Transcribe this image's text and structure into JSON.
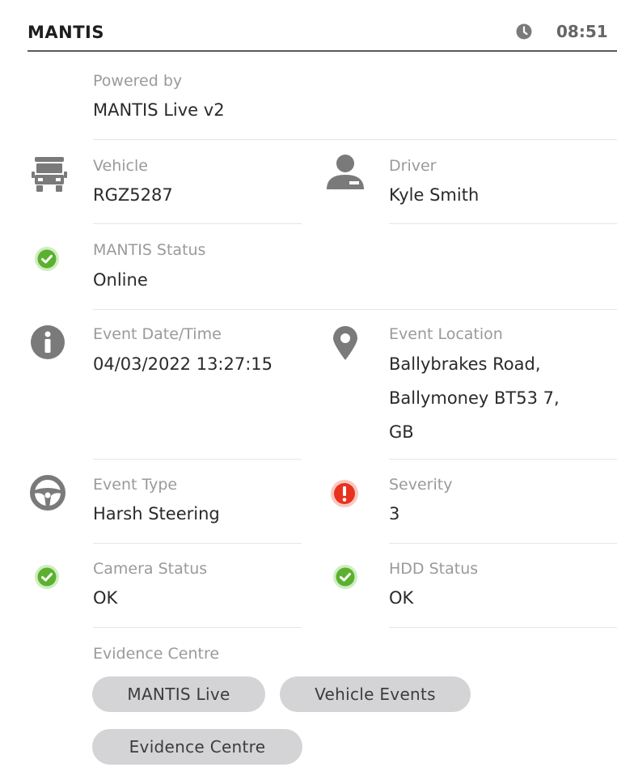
{
  "header": {
    "title": "MANTIS",
    "time": "08:51"
  },
  "powered": {
    "label": "Powered by",
    "value": "MANTIS Live v2"
  },
  "vehicle": {
    "label": "Vehicle",
    "value": "RGZ5287"
  },
  "driver": {
    "label": "Driver",
    "value": "Kyle Smith"
  },
  "mantis_status": {
    "label": "MANTIS Status",
    "value": "Online"
  },
  "event_datetime": {
    "label": "Event Date/Time",
    "value": "04/03/2022 13:27:15"
  },
  "event_location": {
    "label": "Event Location",
    "lines": [
      "Ballybrakes Road,",
      "Ballymoney BT53 7,",
      "GB"
    ]
  },
  "event_type": {
    "label": "Event Type",
    "value": "Harsh Steering"
  },
  "severity": {
    "label": "Severity",
    "value": "3"
  },
  "camera_status": {
    "label": "Camera Status",
    "value": "OK"
  },
  "hdd_status": {
    "label": "HDD Status",
    "value": "OK"
  },
  "evidence": {
    "label": "Evidence Centre",
    "buttons": [
      "MANTIS Live",
      "Vehicle Events",
      "Evidence Centre"
    ]
  },
  "colors": {
    "ok_green": "#5cb030",
    "alert_red": "#e8321e",
    "icon_gray": "#7a7a7a",
    "button_bg": "#d4d4d6"
  },
  "icons": [
    "clock-icon",
    "truck-icon",
    "driver-icon",
    "check-icon",
    "info-icon",
    "location-pin-icon",
    "steering-wheel-icon",
    "alert-icon"
  ]
}
